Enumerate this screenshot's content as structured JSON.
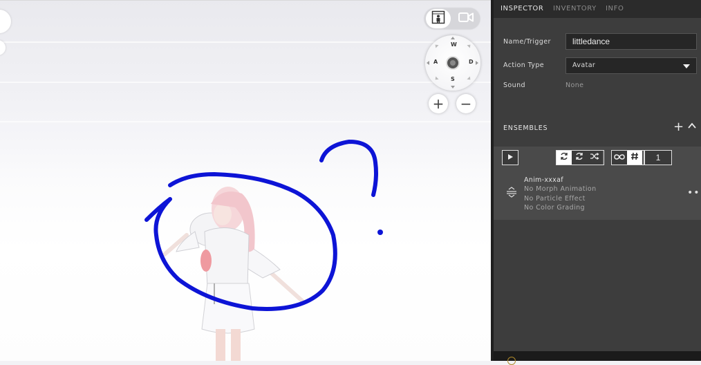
{
  "viewport": {
    "compass": {
      "north": "W",
      "west": "A",
      "east": "D",
      "south": "S"
    },
    "zoom_in_label": "+",
    "zoom_out_label": "−",
    "annotation_color": "#0d14d6"
  },
  "inspector": {
    "tabs": [
      {
        "label": "INSPECTOR",
        "active": true
      },
      {
        "label": "INVENTORY",
        "active": false
      },
      {
        "label": "INFO",
        "active": false
      }
    ],
    "fields": {
      "name_label": "Name/Trigger",
      "name_value": "littledance",
      "action_label": "Action Type",
      "action_value": "Avatar",
      "sound_label": "Sound",
      "sound_value": "None"
    },
    "ensembles": {
      "title": "ENSEMBLES",
      "add_label": "+",
      "count": "1",
      "item": {
        "name": "Anim-xxxaf",
        "morph": "No Morph Animation",
        "particle": "No Particle Effect",
        "color": "No Color Grading"
      }
    }
  },
  "colors": {
    "panel_bg": "#3d3d3d",
    "tab_bar_bg": "#2b2b2b",
    "ensemble_bg": "#4a4a4a"
  }
}
